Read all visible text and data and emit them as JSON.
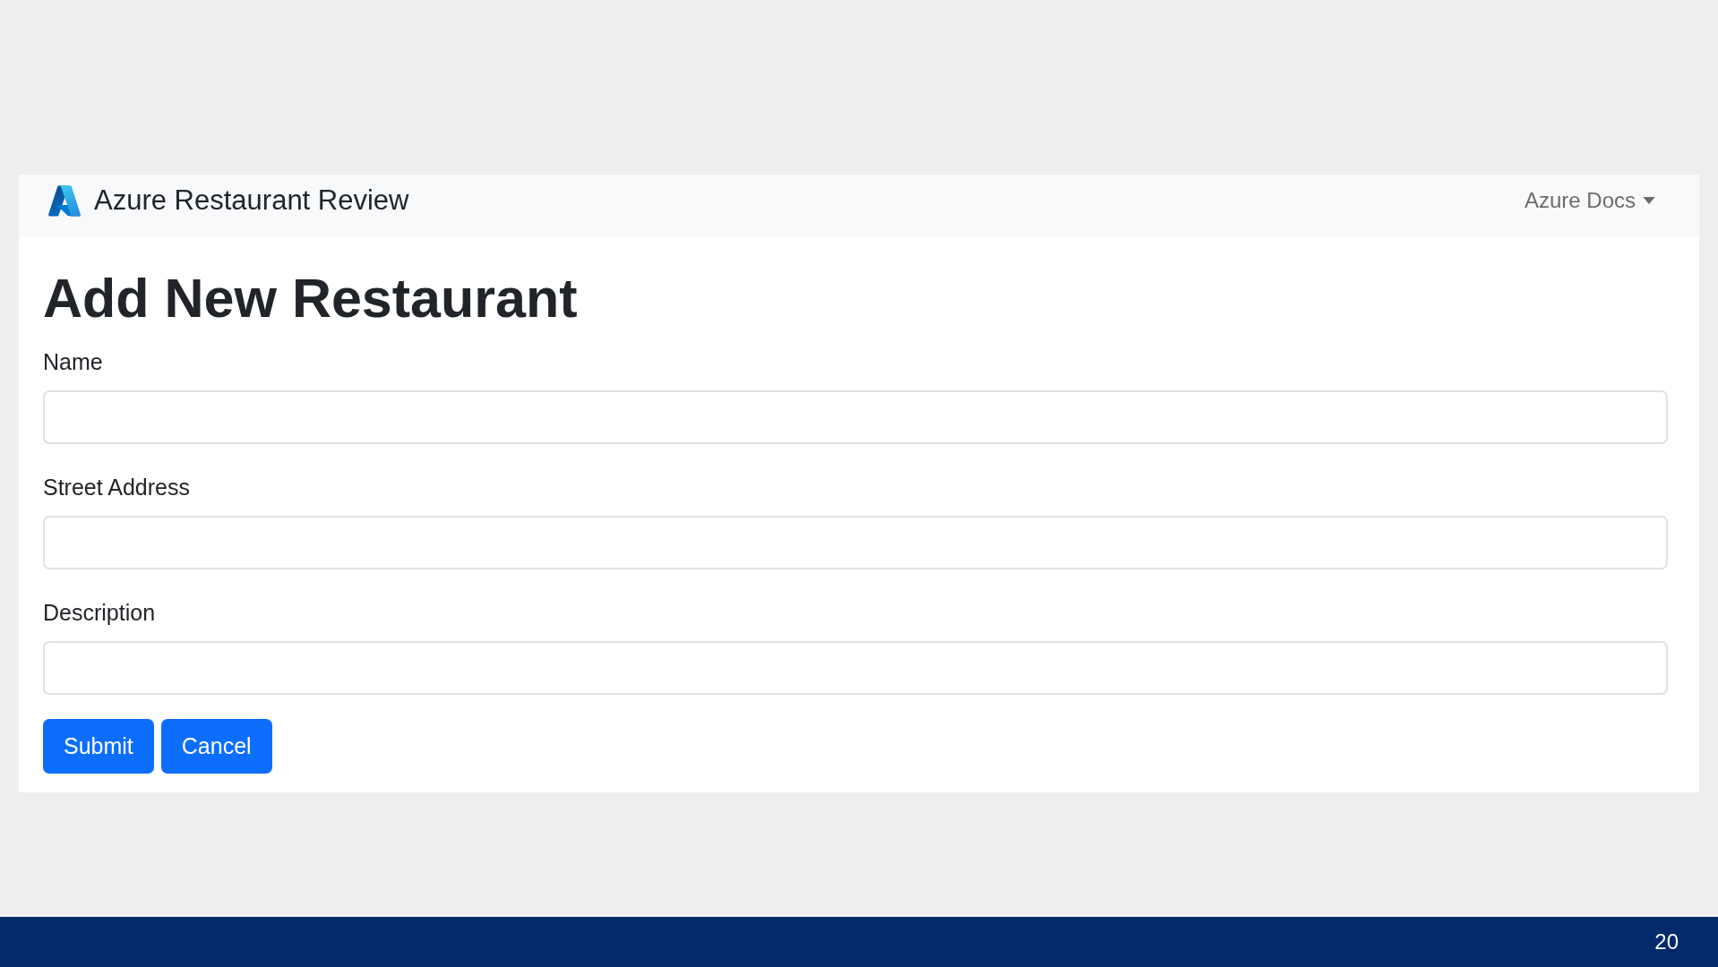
{
  "navbar": {
    "brand": "Azure Restaurant Review",
    "menu": {
      "label": "Azure Docs"
    }
  },
  "page": {
    "heading": "Add New Restaurant"
  },
  "form": {
    "fields": [
      {
        "label": "Name"
      },
      {
        "label": "Street Address"
      },
      {
        "label": "Description"
      }
    ],
    "buttons": [
      "Submit",
      "Cancel"
    ]
  },
  "footer_bar": {
    "page_number": "20"
  }
}
